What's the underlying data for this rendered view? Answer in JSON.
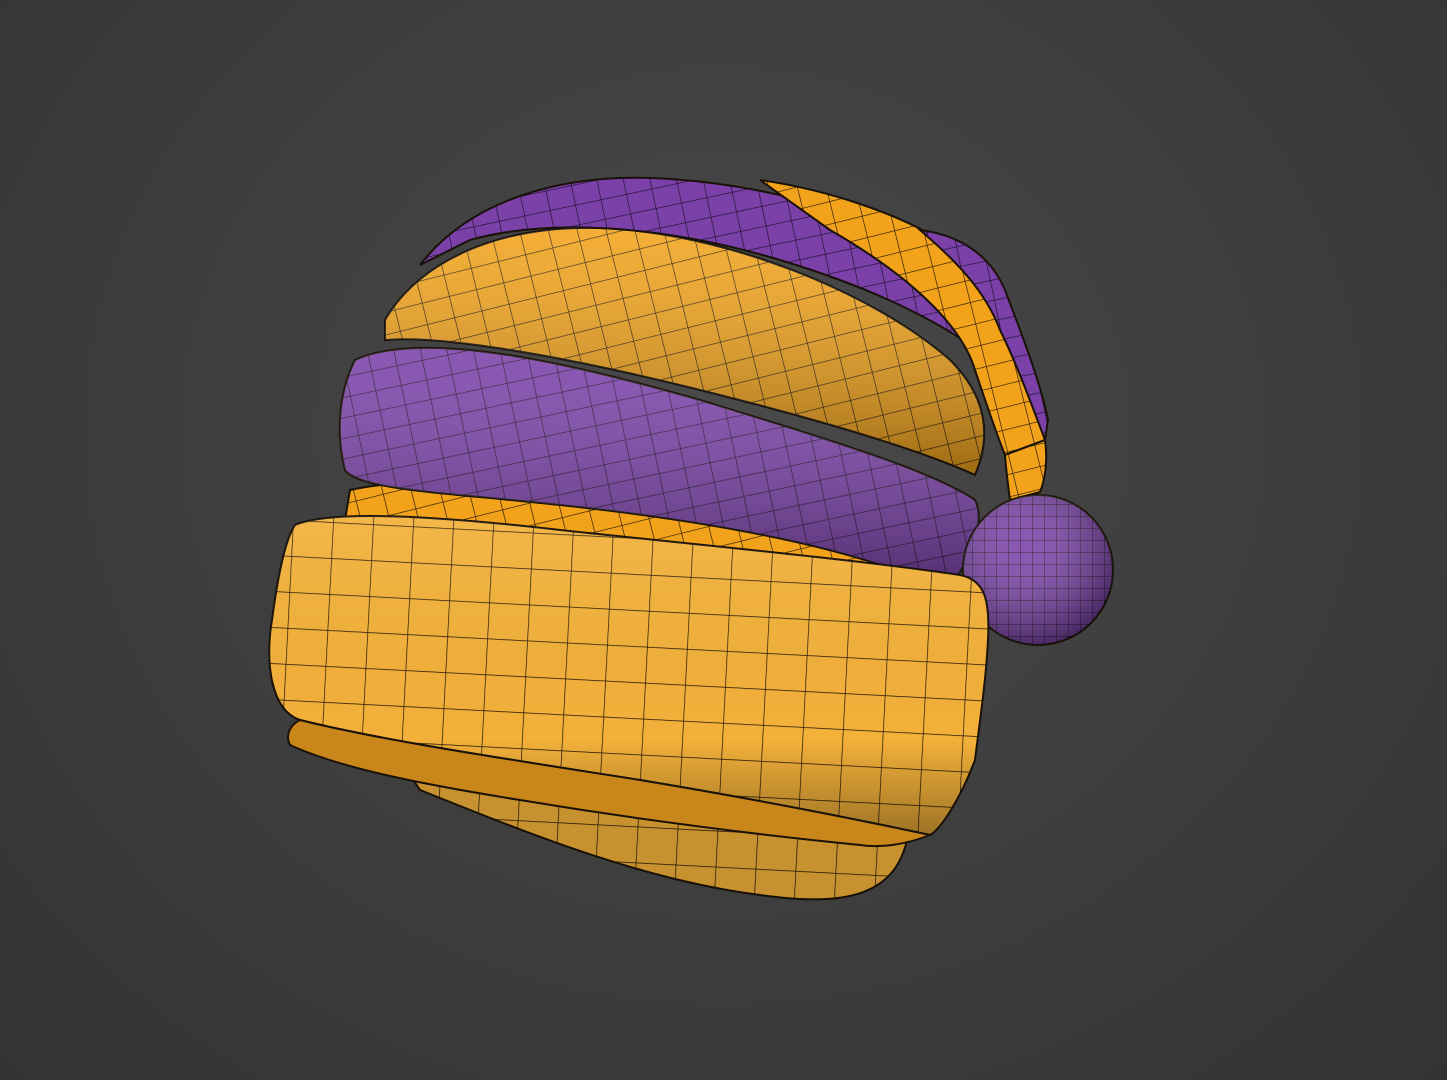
{
  "scene": {
    "subject": "hat-3d-model",
    "render_mode": "textured-with-wireframe",
    "colors": {
      "background": "#3f3f3f",
      "purple": "#7a3fa8",
      "purple_dark": "#4e2470",
      "orange": "#f2a31b",
      "orange_dark": "#c77d0a",
      "cuff": "#f3b13a",
      "cuff_dark": "#d48a17",
      "wire": "#1a1208"
    }
  }
}
